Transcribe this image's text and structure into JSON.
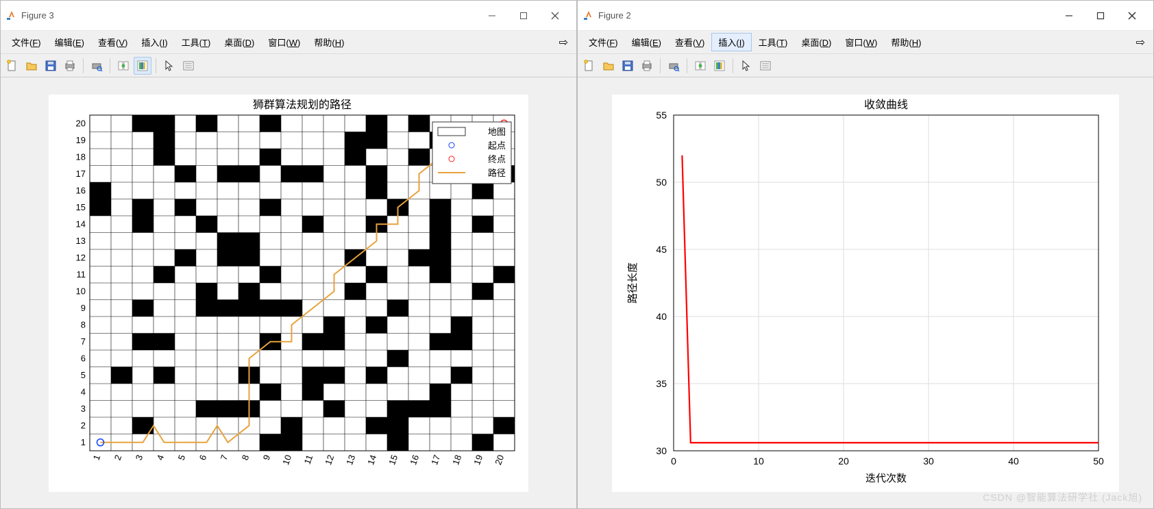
{
  "windows": [
    {
      "title": "Figure 3"
    },
    {
      "title": "Figure 2"
    }
  ],
  "menus": [
    {
      "label": "文件",
      "key": "F"
    },
    {
      "label": "编辑",
      "key": "E"
    },
    {
      "label": "查看",
      "key": "V"
    },
    {
      "label": "插入",
      "key": "I"
    },
    {
      "label": "工具",
      "key": "T"
    },
    {
      "label": "桌面",
      "key": "D"
    },
    {
      "label": "窗口",
      "key": "W"
    },
    {
      "label": "帮助",
      "key": "H"
    }
  ],
  "legend": {
    "map": "地图",
    "start": "起点",
    "end": "终点",
    "path": "路径"
  },
  "watermark": "CSDN @智能算法研学社  (Jack旭)",
  "chart_data": [
    {
      "type": "heatmap",
      "title": "狮群算法规划的路径",
      "xlabel": "",
      "ylabel": "",
      "xlim": [
        1,
        20
      ],
      "ylim": [
        1,
        20
      ],
      "x_ticks": [
        1,
        2,
        3,
        4,
        5,
        6,
        7,
        8,
        9,
        10,
        11,
        12,
        13,
        14,
        15,
        16,
        17,
        18,
        19,
        20
      ],
      "y_ticks": [
        1,
        2,
        3,
        4,
        5,
        6,
        7,
        8,
        9,
        10,
        11,
        12,
        13,
        14,
        15,
        16,
        17,
        18,
        19,
        20
      ],
      "obstacles": [
        [
          20,
          3
        ],
        [
          20,
          4
        ],
        [
          20,
          6
        ],
        [
          20,
          9
        ],
        [
          20,
          14
        ],
        [
          20,
          16
        ],
        [
          19,
          4
        ],
        [
          19,
          13
        ],
        [
          19,
          14
        ],
        [
          19,
          17
        ],
        [
          19,
          18
        ],
        [
          18,
          4
        ],
        [
          18,
          9
        ],
        [
          18,
          13
        ],
        [
          18,
          16
        ],
        [
          17,
          5
        ],
        [
          17,
          7
        ],
        [
          17,
          8
        ],
        [
          17,
          10
        ],
        [
          17,
          11
        ],
        [
          17,
          14
        ],
        [
          17,
          20
        ],
        [
          16,
          1
        ],
        [
          16,
          14
        ],
        [
          16,
          19
        ],
        [
          15,
          1
        ],
        [
          15,
          3
        ],
        [
          15,
          5
        ],
        [
          15,
          9
        ],
        [
          15,
          15
        ],
        [
          15,
          17
        ],
        [
          14,
          3
        ],
        [
          14,
          6
        ],
        [
          14,
          11
        ],
        [
          14,
          14
        ],
        [
          14,
          17
        ],
        [
          14,
          19
        ],
        [
          13,
          7
        ],
        [
          13,
          8
        ],
        [
          13,
          17
        ],
        [
          12,
          5
        ],
        [
          12,
          7
        ],
        [
          12,
          8
        ],
        [
          12,
          13
        ],
        [
          12,
          16
        ],
        [
          12,
          17
        ],
        [
          11,
          4
        ],
        [
          11,
          9
        ],
        [
          11,
          14
        ],
        [
          11,
          17
        ],
        [
          11,
          20
        ],
        [
          10,
          6
        ],
        [
          10,
          8
        ],
        [
          10,
          13
        ],
        [
          10,
          19
        ],
        [
          9,
          3
        ],
        [
          9,
          6
        ],
        [
          9,
          7
        ],
        [
          9,
          8
        ],
        [
          9,
          9
        ],
        [
          9,
          10
        ],
        [
          9,
          15
        ],
        [
          8,
          12
        ],
        [
          8,
          14
        ],
        [
          8,
          18
        ],
        [
          7,
          3
        ],
        [
          7,
          4
        ],
        [
          7,
          9
        ],
        [
          7,
          11
        ],
        [
          7,
          12
        ],
        [
          7,
          17
        ],
        [
          7,
          18
        ],
        [
          6,
          15
        ],
        [
          5,
          2
        ],
        [
          5,
          4
        ],
        [
          5,
          8
        ],
        [
          5,
          11
        ],
        [
          5,
          12
        ],
        [
          5,
          14
        ],
        [
          5,
          18
        ],
        [
          4,
          9
        ],
        [
          4,
          11
        ],
        [
          4,
          17
        ],
        [
          3,
          6
        ],
        [
          3,
          7
        ],
        [
          3,
          8
        ],
        [
          3,
          12
        ],
        [
          3,
          15
        ],
        [
          3,
          16
        ],
        [
          3,
          17
        ],
        [
          2,
          3
        ],
        [
          2,
          10
        ],
        [
          2,
          14
        ],
        [
          2,
          15
        ],
        [
          2,
          20
        ],
        [
          1,
          9
        ],
        [
          1,
          10
        ],
        [
          1,
          15
        ],
        [
          1,
          19
        ]
      ],
      "start": [
        1,
        1
      ],
      "end": [
        20,
        20
      ],
      "path": [
        [
          1,
          1
        ],
        [
          2,
          1
        ],
        [
          3,
          1
        ],
        [
          3.5,
          2
        ],
        [
          4,
          1
        ],
        [
          5,
          1
        ],
        [
          6,
          1
        ],
        [
          6.5,
          2
        ],
        [
          7,
          1
        ],
        [
          8,
          2
        ],
        [
          8,
          3
        ],
        [
          8,
          4
        ],
        [
          8,
          5
        ],
        [
          8,
          6
        ],
        [
          9,
          7
        ],
        [
          10,
          7
        ],
        [
          10,
          8
        ],
        [
          11,
          9
        ],
        [
          12,
          10
        ],
        [
          12,
          11
        ],
        [
          13,
          12
        ],
        [
          14,
          13
        ],
        [
          14,
          14
        ],
        [
          15,
          14
        ],
        [
          15,
          15
        ],
        [
          16,
          16
        ],
        [
          16,
          17
        ],
        [
          17,
          18
        ],
        [
          18,
          19
        ],
        [
          19,
          20
        ],
        [
          20,
          20
        ]
      ]
    },
    {
      "type": "line",
      "title": "收敛曲线",
      "xlabel": "迭代次数",
      "ylabel": "路径长度",
      "xlim": [
        0,
        50
      ],
      "ylim": [
        30,
        55
      ],
      "x_ticks": [
        0,
        10,
        20,
        30,
        40,
        50
      ],
      "y_ticks": [
        30,
        35,
        40,
        45,
        50,
        55
      ],
      "series": [
        {
          "name": "fitness",
          "color": "#ff0000",
          "x": [
            1,
            2,
            3,
            4,
            5,
            6,
            7,
            8,
            9,
            10,
            15,
            20,
            25,
            30,
            35,
            40,
            45,
            50
          ],
          "y": [
            52,
            30.6,
            30.6,
            30.6,
            30.6,
            30.6,
            30.6,
            30.6,
            30.6,
            30.6,
            30.6,
            30.6,
            30.6,
            30.6,
            30.6,
            30.6,
            30.6,
            30.6
          ]
        }
      ]
    }
  ]
}
